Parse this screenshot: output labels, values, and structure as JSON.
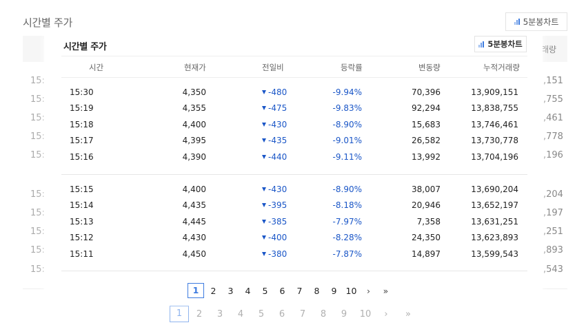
{
  "background": {
    "title": "시간별 주가",
    "chart_button": "5분봉차트",
    "column_label": "래량",
    "left_values": [
      "15:",
      "15:",
      "15:",
      "15:",
      "15:",
      "15:",
      "15:",
      "15:",
      "15:",
      "15:"
    ],
    "right_values": [
      ",151",
      ",755",
      ",461",
      ",778",
      ",196",
      ",204",
      ",197",
      ",251",
      ",893",
      ",543"
    ],
    "pagination": [
      "1",
      "2",
      "3",
      "4",
      "5",
      "6",
      "7",
      "8",
      "9",
      "10",
      "›",
      "»"
    ]
  },
  "popup": {
    "title": "시간별 주가",
    "chart_button": "5분봉차트",
    "columns": [
      "시간",
      "현재가",
      "전일비",
      "등락률",
      "변동량",
      "누적거래량"
    ],
    "rows": [
      {
        "time": "15:30",
        "price": "4,350",
        "diff": "-480",
        "rate": "-9.94%",
        "volume": "70,396",
        "cumulative": "13,909,151"
      },
      {
        "time": "15:19",
        "price": "4,355",
        "diff": "-475",
        "rate": "-9.83%",
        "volume": "92,294",
        "cumulative": "13,838,755"
      },
      {
        "time": "15:18",
        "price": "4,400",
        "diff": "-430",
        "rate": "-8.90%",
        "volume": "15,683",
        "cumulative": "13,746,461"
      },
      {
        "time": "15:17",
        "price": "4,395",
        "diff": "-435",
        "rate": "-9.01%",
        "volume": "26,582",
        "cumulative": "13,730,778"
      },
      {
        "time": "15:16",
        "price": "4,390",
        "diff": "-440",
        "rate": "-9.11%",
        "volume": "13,992",
        "cumulative": "13,704,196"
      },
      {
        "time": "15:15",
        "price": "4,400",
        "diff": "-430",
        "rate": "-8.90%",
        "volume": "38,007",
        "cumulative": "13,690,204"
      },
      {
        "time": "15:14",
        "price": "4,435",
        "diff": "-395",
        "rate": "-8.18%",
        "volume": "20,946",
        "cumulative": "13,652,197"
      },
      {
        "time": "15:13",
        "price": "4,445",
        "diff": "-385",
        "rate": "-7.97%",
        "volume": "7,358",
        "cumulative": "13,631,251"
      },
      {
        "time": "15:12",
        "price": "4,430",
        "diff": "-400",
        "rate": "-8.28%",
        "volume": "24,350",
        "cumulative": "13,623,893"
      },
      {
        "time": "15:11",
        "price": "4,450",
        "diff": "-380",
        "rate": "-7.87%",
        "volume": "14,897",
        "cumulative": "13,599,543"
      }
    ],
    "pagination": {
      "current": "1",
      "pages": [
        "2",
        "3",
        "4",
        "5",
        "6",
        "7",
        "8",
        "9",
        "10"
      ],
      "next": "›",
      "last": "»"
    }
  },
  "colors": {
    "accent": "#3d7be0",
    "down": "#1a56c7"
  },
  "icons": {
    "chart": "bar-chart-icon",
    "down": "triangle-down-icon"
  }
}
